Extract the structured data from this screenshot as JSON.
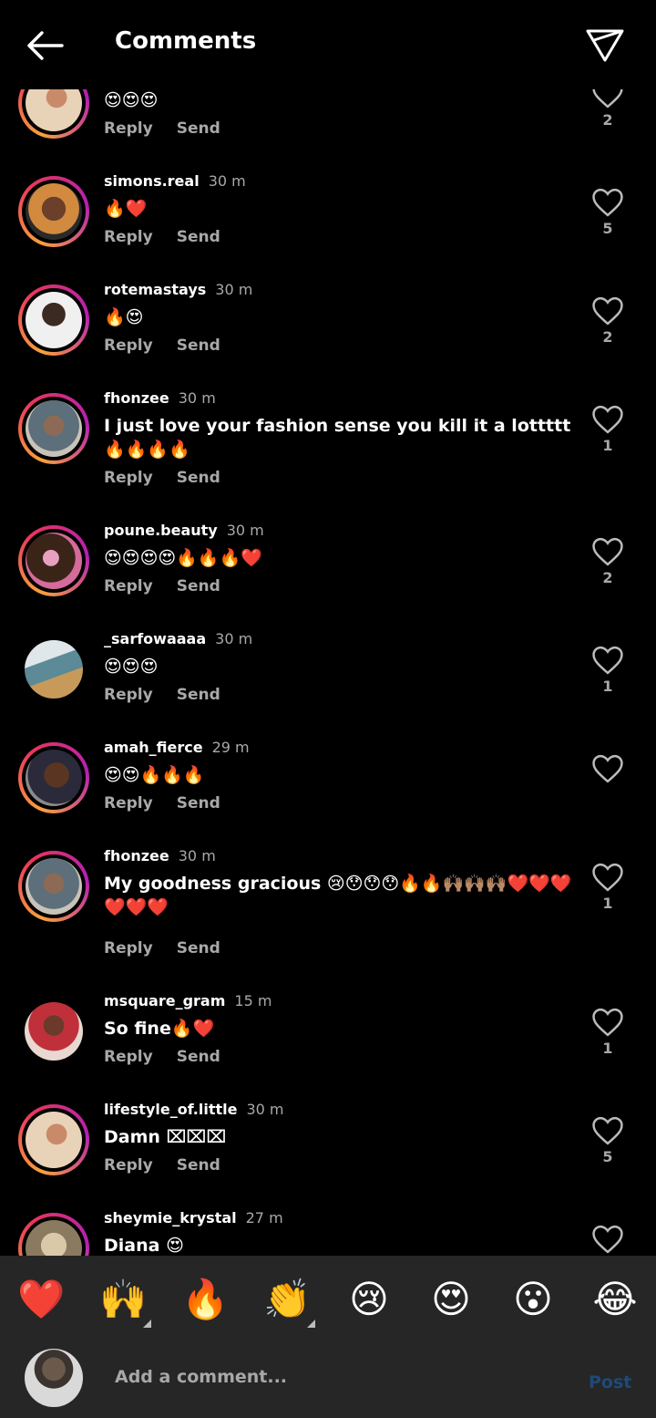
{
  "header": {
    "title": "Comments"
  },
  "actions": {
    "reply": "Reply",
    "send": "Send"
  },
  "comments": [
    {
      "username": "",
      "time": "",
      "text": "😍😍😍",
      "likes": "2"
    },
    {
      "username": "simons.real",
      "time": "30 m",
      "text": "🔥❤️",
      "likes": "5"
    },
    {
      "username": "rotemastays",
      "time": "30 m",
      "text": "🔥😍",
      "likes": "2"
    },
    {
      "username": "fhonzee",
      "time": "30 m",
      "text": "I just love your fashion sense you kill it a lottttt🔥🔥🔥🔥",
      "likes": "1"
    },
    {
      "username": "poune.beauty",
      "time": "30 m",
      "text": "😍😍😍😍🔥🔥🔥❤️",
      "likes": "2"
    },
    {
      "username": "_sarfowaaaa",
      "time": "30 m",
      "text": "😍😍😍",
      "likes": "1"
    },
    {
      "username": "amah_fierce",
      "time": "29 m",
      "text": "😍😍🔥🔥🔥",
      "likes": ""
    },
    {
      "username": "fhonzee",
      "time": "30 m",
      "text": "My goodness gracious 😢😯😯😯🔥🔥🙌🏽🙌🏽🙌🏽❤️❤️❤️❤️❤️❤️",
      "likes": "1"
    },
    {
      "username": "msquare_gram",
      "time": "15 m",
      "text": "So fine🔥❤️",
      "likes": "1"
    },
    {
      "username": "lifestyle_of.little",
      "time": "30 m",
      "text": "Damn ⌧⌧⌧",
      "likes": "5"
    },
    {
      "username": "sheymie_krystal",
      "time": "27 m",
      "text": "Diana 😍",
      "likes": ""
    }
  ],
  "emoji_bar": [
    "❤️",
    "🙌",
    "🔥",
    "👏",
    "😢",
    "😍",
    "😮",
    "😂"
  ],
  "input": {
    "placeholder": "Add a comment...",
    "post": "Post"
  }
}
